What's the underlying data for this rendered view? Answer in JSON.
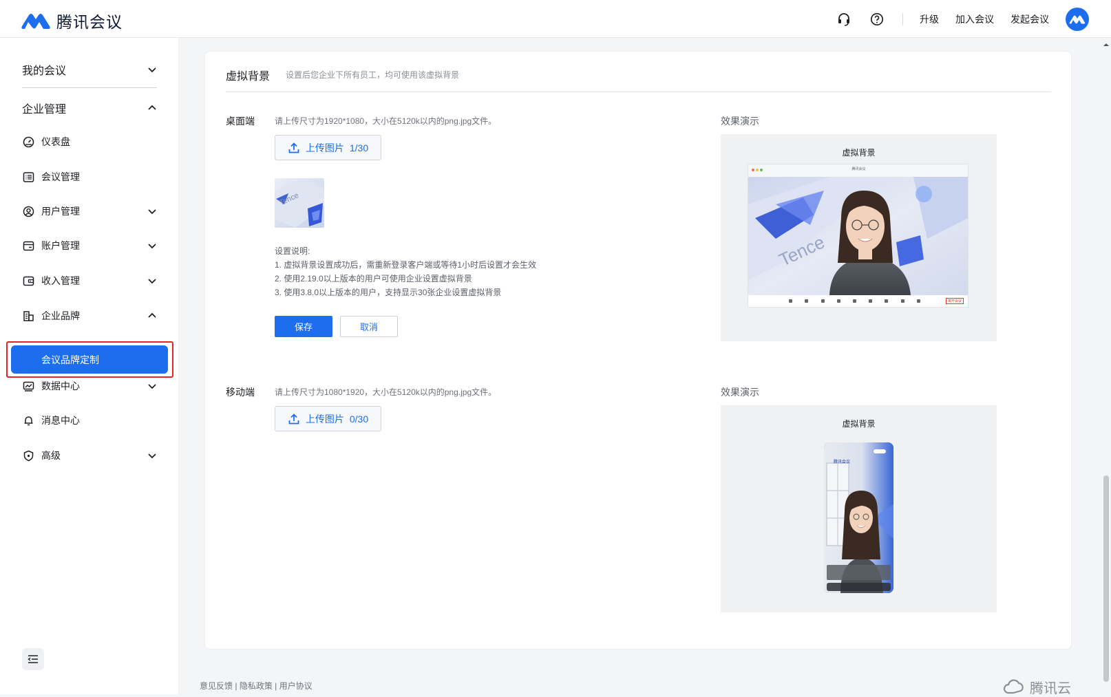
{
  "app": {
    "name": "腾讯会议"
  },
  "topbar": {
    "links": [
      "升级",
      "加入会议",
      "发起会议"
    ],
    "icons": [
      "headset-icon",
      "help-icon"
    ]
  },
  "sidebar": {
    "my_meetings": "我的会议",
    "enterprise": "企业管理",
    "items": [
      {
        "label": "仪表盘",
        "icon": "dashboard-icon"
      },
      {
        "label": "会议管理",
        "icon": "list-icon"
      },
      {
        "label": "用户管理",
        "icon": "user-icon"
      },
      {
        "label": "账户管理",
        "icon": "card-icon"
      },
      {
        "label": "收入管理",
        "icon": "wallet-icon"
      },
      {
        "label": "企业品牌",
        "icon": "building-icon"
      },
      {
        "label": "数据中心",
        "icon": "chart-icon"
      },
      {
        "label": "消息中心",
        "icon": "bell-icon"
      },
      {
        "label": "高级",
        "icon": "shield-icon"
      }
    ],
    "active_sub": "会议品牌定制"
  },
  "card": {
    "title": "虚拟背景",
    "subtitle": "设置后您企业下所有员工，均可使用该虚拟背景",
    "desktop": {
      "label": "桌面端",
      "hint": "请上传尺寸为1920*1080，大小在5120k以内的png.jpg文件。",
      "upload_label": "上传图片",
      "upload_count": "1/30",
      "notes": [
        "设置说明:",
        "1. 虚拟背景设置成功后，需重新登录客户端或等待1小时后设置才会生效",
        "2. 使用2.19.0以上版本的用户可使用企业设置虚拟背景",
        "3. 使用3.8.0以上版本的用户，支持显示30张企业设置虚拟背景"
      ],
      "save": "保存",
      "cancel": "取消",
      "demo_label": "效果演示",
      "demo_title": "虚拟背景",
      "demo_window_title": "腾讯会议",
      "demo_end": "离开会议"
    },
    "mobile": {
      "label": "移动端",
      "hint": "请上传尺寸为1080*1920，大小在5120k以内的png.jpg文件。",
      "upload_label": "上传图片",
      "upload_count": "0/30",
      "demo_label": "效果演示",
      "demo_title": "虚拟背景",
      "demo_brand": "腾讯会议"
    }
  },
  "footer": {
    "links": [
      "意见反馈",
      "隐私政策",
      "用户协议"
    ],
    "separator": " | ",
    "brand": "腾讯云"
  },
  "colors": {
    "accent": "#1c6eef",
    "highlight": "#e22425"
  }
}
